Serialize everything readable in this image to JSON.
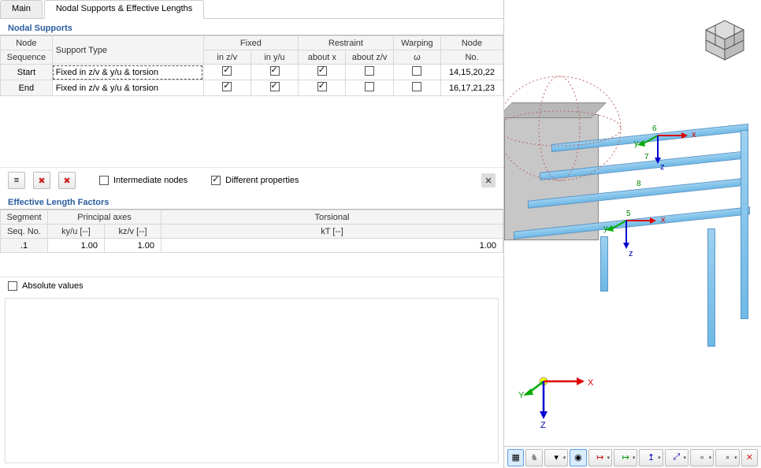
{
  "tabs": {
    "main": "Main",
    "current": "Nodal Supports & Effective Lengths"
  },
  "nodal_supports": {
    "title": "Nodal Supports",
    "headers": {
      "node_seq_line1": "Node",
      "node_seq_line2": "Sequence",
      "support_type": "Support Type",
      "fixed": "Fixed",
      "in_zv": "in z/v",
      "in_yu": "in y/u",
      "restraint": "Restraint",
      "about_x": "about x",
      "about_zv": "about z/v",
      "warping": "Warping",
      "omega": "ω",
      "node_line1": "Node",
      "node_no": "No."
    },
    "rows": [
      {
        "seq": "Start",
        "type": "Fixed in z/v & y/u & torsion",
        "fixed_zv": true,
        "fixed_yu": true,
        "r_about_x": true,
        "r_about_zv": false,
        "warping": false,
        "nodes": "14,15,20,22"
      },
      {
        "seq": "End",
        "type": "Fixed in z/v & y/u & torsion",
        "fixed_zv": true,
        "fixed_yu": true,
        "r_about_x": true,
        "r_about_zv": false,
        "warping": false,
        "nodes": "16,17,21,23"
      }
    ],
    "intermediate_nodes": {
      "label": "Intermediate nodes",
      "checked": false
    },
    "different_properties": {
      "label": "Different properties",
      "checked": true
    }
  },
  "effective_lengths": {
    "title": "Effective Length Factors",
    "headers": {
      "segment_line1": "Segment",
      "segment_line2": "Seq. No.",
      "principal": "Principal axes",
      "kyu": "ky/u [--]",
      "kzv": "kz/v [--]",
      "torsional": "Torsional",
      "kT": "kT [--]"
    },
    "rows": [
      {
        "seq": ".1",
        "kyu": "1.00",
        "kzv": "1.00",
        "kT": "1.00"
      }
    ],
    "absolute": {
      "label": "Absolute values",
      "checked": false
    }
  },
  "view3d": {
    "member_labels": [
      "5",
      "6",
      "7",
      "8"
    ],
    "axes": {
      "x": "X",
      "y": "Y",
      "z": "Z"
    },
    "small_axes": {
      "x": "x",
      "y": "y",
      "z": "z"
    }
  },
  "toolbar3d": {
    "tools": [
      {
        "name": "view-solid-icon",
        "active": true
      },
      {
        "name": "view-wire-icon",
        "active": false
      },
      {
        "name": "show-loads-icon",
        "active": false
      },
      {
        "name": "show-results-icon",
        "active": true
      },
      {
        "name": "view-x-icon",
        "active": false
      },
      {
        "name": "view-y-icon",
        "active": false
      },
      {
        "name": "view-z-icon",
        "active": false
      },
      {
        "name": "view-iso-icon",
        "active": false
      },
      {
        "name": "display-icon",
        "active": false
      },
      {
        "name": "layer-icon",
        "active": false
      },
      {
        "name": "zoom-fit-icon",
        "active": false
      }
    ]
  }
}
